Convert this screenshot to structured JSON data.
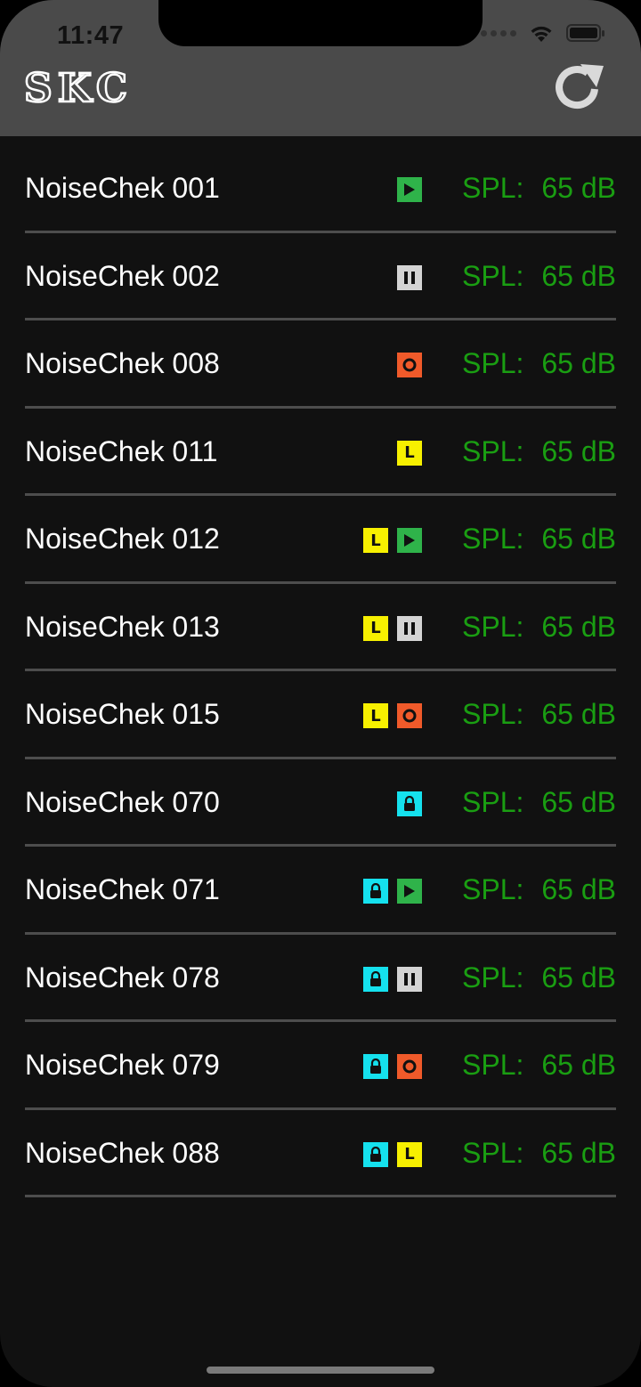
{
  "status_bar": {
    "time": "11:47"
  },
  "header": {
    "logo_text": "SKC"
  },
  "devices": [
    {
      "name": "NoiseChek 001",
      "badges": [
        "play"
      ],
      "spl_label": "SPL:",
      "spl_value": "65 dB"
    },
    {
      "name": "NoiseChek 002",
      "badges": [
        "pause"
      ],
      "spl_label": "SPL:",
      "spl_value": "65 dB"
    },
    {
      "name": "NoiseChek 008",
      "badges": [
        "record"
      ],
      "spl_label": "SPL:",
      "spl_value": "65 dB"
    },
    {
      "name": "NoiseChek 011",
      "badges": [
        "level"
      ],
      "spl_label": "SPL:",
      "spl_value": "65 dB"
    },
    {
      "name": "NoiseChek 012",
      "badges": [
        "level",
        "play"
      ],
      "spl_label": "SPL:",
      "spl_value": "65 dB"
    },
    {
      "name": "NoiseChek 013",
      "badges": [
        "level",
        "pause"
      ],
      "spl_label": "SPL:",
      "spl_value": "65 dB"
    },
    {
      "name": "NoiseChek 015",
      "badges": [
        "level",
        "record"
      ],
      "spl_label": "SPL:",
      "spl_value": "65 dB"
    },
    {
      "name": "NoiseChek 070",
      "badges": [
        "lock"
      ],
      "spl_label": "SPL:",
      "spl_value": "65 dB"
    },
    {
      "name": "NoiseChek 071",
      "badges": [
        "lock",
        "play"
      ],
      "spl_label": "SPL:",
      "spl_value": "65 dB"
    },
    {
      "name": "NoiseChek 078",
      "badges": [
        "lock",
        "pause"
      ],
      "spl_label": "SPL:",
      "spl_value": "65 dB"
    },
    {
      "name": "NoiseChek 079",
      "badges": [
        "lock",
        "record"
      ],
      "spl_label": "SPL:",
      "spl_value": "65 dB"
    },
    {
      "name": "NoiseChek 088",
      "badges": [
        "lock",
        "level"
      ],
      "spl_label": "SPL:",
      "spl_value": "65 dB"
    }
  ],
  "badge_labels": {
    "level": "L"
  },
  "colors": {
    "header_bg": "#4a4a4a",
    "list_bg": "#111111",
    "spl_text": "#1a9e12",
    "play": "#2fb34a",
    "pause": "#d4d4d4",
    "record": "#f05a2a",
    "lock": "#15e1ee",
    "level": "#f7f000"
  }
}
